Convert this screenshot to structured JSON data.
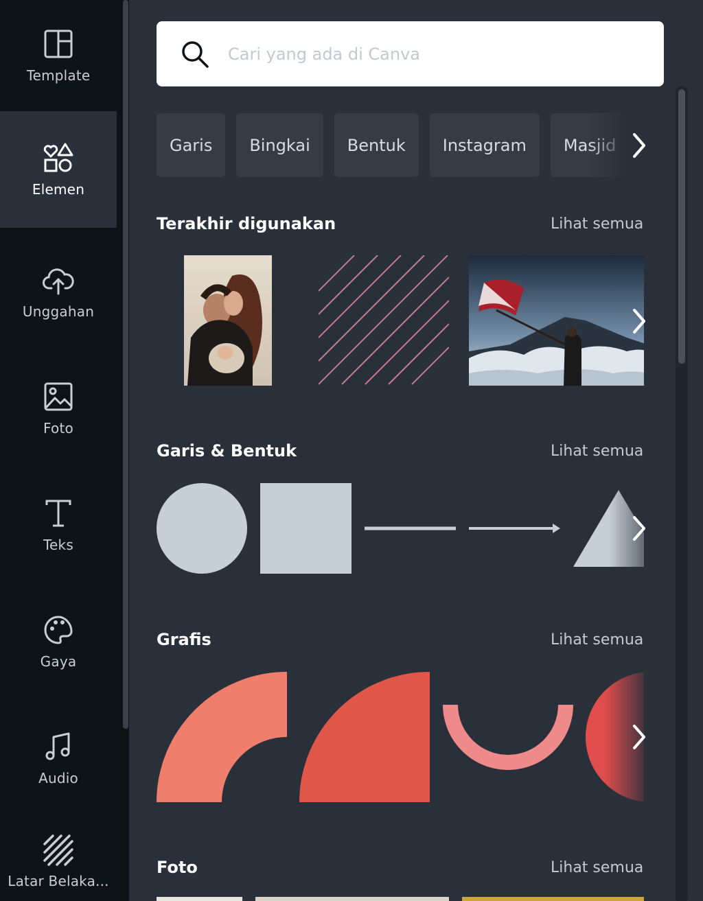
{
  "rail": {
    "items": [
      {
        "label": "Template",
        "icon": "template-icon"
      },
      {
        "label": "Elemen",
        "icon": "elements-icon"
      },
      {
        "label": "Unggahan",
        "icon": "upload-cloud-icon"
      },
      {
        "label": "Foto",
        "icon": "photo-icon"
      },
      {
        "label": "Teks",
        "icon": "text-icon"
      },
      {
        "label": "Gaya",
        "icon": "palette-icon"
      },
      {
        "label": "Audio",
        "icon": "music-note-icon"
      },
      {
        "label": "Latar Belaka...",
        "icon": "background-stripes-icon"
      }
    ],
    "active": "Elemen"
  },
  "search": {
    "placeholder": "Cari yang ada di Canva"
  },
  "chips": [
    "Garis",
    "Bingkai",
    "Bentuk",
    "Instagram",
    "Masjid"
  ],
  "sections": [
    {
      "title": "Terakhir digunakan",
      "see_all": "Lihat semua"
    },
    {
      "title": "Garis & Bentuk",
      "see_all": "Lihat semua"
    },
    {
      "title": "Grafis",
      "see_all": "Lihat semua"
    },
    {
      "title": "Foto",
      "see_all": "Lihat semua"
    }
  ],
  "colors": {
    "rail_bg": "#0e1318",
    "panel_bg": "#293039",
    "chip_bg": "#353c46",
    "shape_fill": "#c6ced8",
    "coral_light": "#ef7e6c",
    "coral": "#e0574a",
    "pink": "#ef8a8a"
  }
}
